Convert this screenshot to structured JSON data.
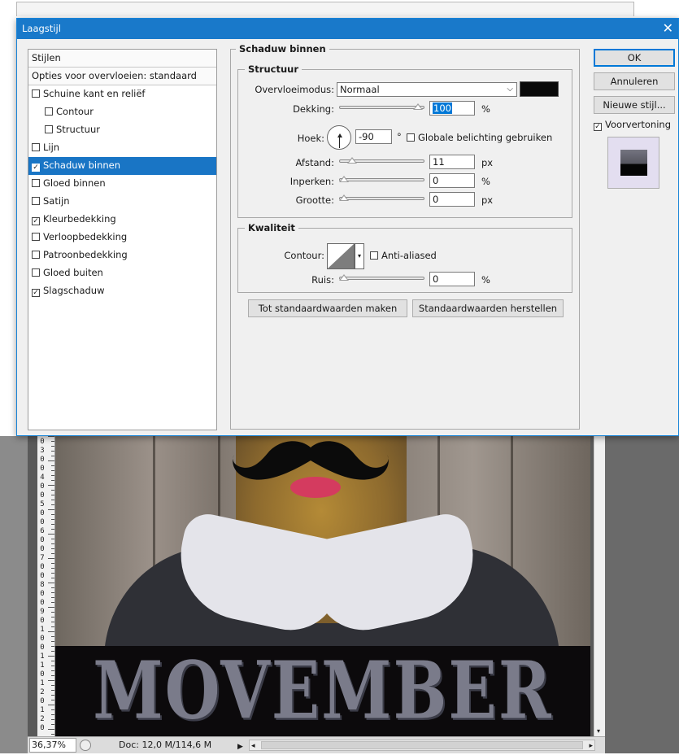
{
  "window": {
    "title": "Laagstijl"
  },
  "styles_panel": {
    "items": [
      {
        "label": "Stijlen",
        "checkbox": false,
        "selected": false
      },
      {
        "label": "Opties voor overvloeien: standaard",
        "checkbox": false,
        "selected": false
      },
      {
        "label": "Schuine kant en reliëf",
        "checkbox": true,
        "checked": false,
        "indent": false
      },
      {
        "label": "Contour",
        "checkbox": true,
        "checked": false,
        "indent": true
      },
      {
        "label": "Structuur",
        "checkbox": true,
        "checked": false,
        "indent": true
      },
      {
        "label": "Lijn",
        "checkbox": true,
        "checked": false
      },
      {
        "label": "Schaduw binnen",
        "checkbox": true,
        "checked": true,
        "selected": true
      },
      {
        "label": "Gloed binnen",
        "checkbox": true,
        "checked": false
      },
      {
        "label": "Satijn",
        "checkbox": true,
        "checked": false
      },
      {
        "label": "Kleurbedekking",
        "checkbox": true,
        "checked": true
      },
      {
        "label": "Verloopbedekking",
        "checkbox": true,
        "checked": false
      },
      {
        "label": "Patroonbedekking",
        "checkbox": true,
        "checked": false
      },
      {
        "label": "Gloed buiten",
        "checkbox": true,
        "checked": false
      },
      {
        "label": "Slagschaduw",
        "checkbox": true,
        "checked": true
      }
    ]
  },
  "settings": {
    "section_title": "Schaduw binnen",
    "structuur": {
      "title": "Structuur",
      "blend_mode_label": "Overvloeimodus:",
      "blend_mode_value": "Normaal",
      "shadow_color": "#0a0a0a",
      "opacity_label": "Dekking:",
      "opacity_value": "100",
      "opacity_unit": "%",
      "opacity_fraction": 1.0,
      "angle_label": "Hoek:",
      "angle_value": "-90",
      "angle_unit": "°",
      "global_light_label": "Globale belichting gebruiken",
      "global_light_checked": false,
      "distance_label": "Afstand:",
      "distance_value": "11",
      "distance_unit": "px",
      "distance_fraction": 0.11,
      "choke_label": "Inperken:",
      "choke_value": "0",
      "choke_unit": "%",
      "choke_fraction": 0,
      "size_label": "Grootte:",
      "size_value": "0",
      "size_unit": "px",
      "size_fraction": 0
    },
    "kwaliteit": {
      "title": "Kwaliteit",
      "contour_label": "Contour:",
      "anti_aliased_label": "Anti-aliased",
      "anti_aliased_checked": false,
      "noise_label": "Ruis:",
      "noise_value": "0",
      "noise_unit": "%",
      "noise_fraction": 0
    },
    "make_default_label": "Tot standaardwaarden maken",
    "reset_default_label": "Standaardwaarden herstellen"
  },
  "buttons": {
    "ok": "OK",
    "cancel": "Annuleren",
    "new_style": "Nieuwe stijl...",
    "preview_label": "Voorvertoning",
    "preview_checked": true
  },
  "document": {
    "poster_text": "MOVEMBER",
    "zoom": "36,37%",
    "doc_size": "Doc: 12,0 M/114,6 M",
    "ruler_digits": [
      "0",
      "3",
      "0",
      "0",
      "4",
      "0",
      "0",
      "5",
      "0",
      "0",
      "6",
      "0",
      "0",
      "7",
      "0",
      "0",
      "8",
      "0",
      "0",
      "9",
      "0",
      "1",
      "0",
      "0",
      "1",
      "1",
      "0",
      "1",
      "2",
      "0",
      "1",
      "2",
      "0"
    ]
  },
  "colors": {
    "title_bar": "#1979ca",
    "selection": "#1975c5",
    "button_focus": "#0078d7"
  }
}
